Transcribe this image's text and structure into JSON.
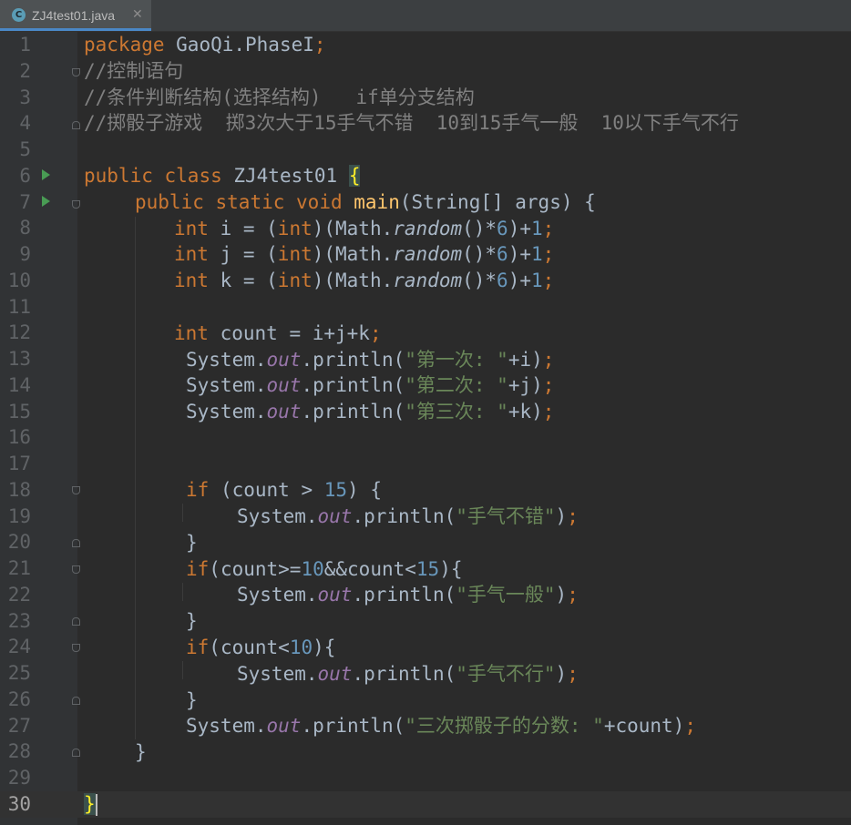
{
  "tab": {
    "icon": "java-class-icon",
    "icon_letter": "C",
    "file_name": "ZJ4test01.java",
    "close": "✕"
  },
  "current_line": 30,
  "line_numbers": [
    "1",
    "2",
    "3",
    "4",
    "5",
    "6",
    "7",
    "8",
    "9",
    "10",
    "11",
    "12",
    "13",
    "14",
    "15",
    "16",
    "17",
    "18",
    "19",
    "20",
    "21",
    "22",
    "23",
    "24",
    "25",
    "26",
    "27",
    "28",
    "29",
    "30"
  ],
  "code": {
    "l1": [
      "package",
      " GaoQi.PhaseI",
      ";"
    ],
    "l2": "//控制语句",
    "l3": "//条件判断结构(选择结构)   if单分支结构",
    "l4": "//掷骰子游戏  掷3次大于15手气不错  10到15手气一般  10以下手气不行",
    "l6": [
      "public",
      " ",
      "class",
      " ZJ4test01 ",
      "{"
    ],
    "l7": [
      "public",
      " ",
      "static",
      " ",
      "void",
      " ",
      "main",
      "(String[] args) {"
    ],
    "l8": [
      "int",
      " i = (",
      "int",
      ")(Math.",
      "random",
      "()*",
      "6",
      ")+",
      "1",
      ";"
    ],
    "l9": [
      "int",
      " j = (",
      "int",
      ")(Math.",
      "random",
      "()*",
      "6",
      ")+",
      "1",
      ";"
    ],
    "l10": [
      "int",
      " k = (",
      "int",
      ")(Math.",
      "random",
      "()*",
      "6",
      ")+",
      "1",
      ";"
    ],
    "l12": [
      "int",
      " count = i+j+k",
      ";"
    ],
    "l13": [
      "System.",
      "out",
      ".println(",
      "\"第一次: \"",
      "+i)",
      ";"
    ],
    "l14": [
      "System.",
      "out",
      ".println(",
      "\"第二次: \"",
      "+j)",
      ";"
    ],
    "l15": [
      "System.",
      "out",
      ".println(",
      "\"第三次: \"",
      "+k)",
      ";"
    ],
    "l18": [
      "if",
      " (count > ",
      "15",
      ") {"
    ],
    "l19": [
      "System.",
      "out",
      ".println(",
      "\"手气不错\"",
      ")",
      ";"
    ],
    "l20": "}",
    "l21": [
      "if",
      "(count>=",
      "10",
      "&&count<",
      "15",
      "){"
    ],
    "l22": [
      "System.",
      "out",
      ".println(",
      "\"手气一般\"",
      ")",
      ";"
    ],
    "l23": "}",
    "l24": [
      "if",
      "(count<",
      "10",
      "){"
    ],
    "l25": [
      "System.",
      "out",
      ".println(",
      "\"手气不行\"",
      ")",
      ";"
    ],
    "l26": "}",
    "l27": [
      "System.",
      "out",
      ".println(",
      "\"三次掷骰子的分数: \"",
      "+count)",
      ";"
    ],
    "l28": "}",
    "l30": "}"
  }
}
